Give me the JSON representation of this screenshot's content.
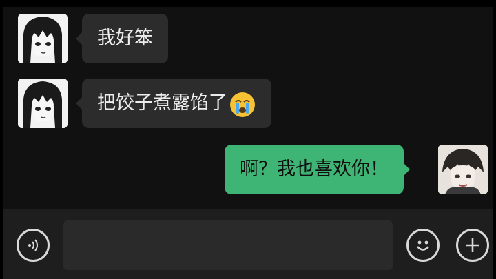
{
  "chat": {
    "messages": [
      {
        "side": "incoming",
        "text": "我好笨"
      },
      {
        "side": "incoming",
        "text": "把饺子煮露馅了",
        "emoji": "crying-face-icon"
      },
      {
        "side": "outgoing",
        "text": "啊？我也喜欢你！"
      }
    ]
  },
  "input_bar": {
    "voice_icon": "voice-icon",
    "text_value": "",
    "emoji_icon": "smiley-icon",
    "add_icon": "plus-icon"
  },
  "colors": {
    "chat_background": "#111111",
    "incoming_bubble": "#2c2c2c",
    "outgoing_bubble": "#3eb575",
    "input_bar_background": "#1e1e1e"
  }
}
